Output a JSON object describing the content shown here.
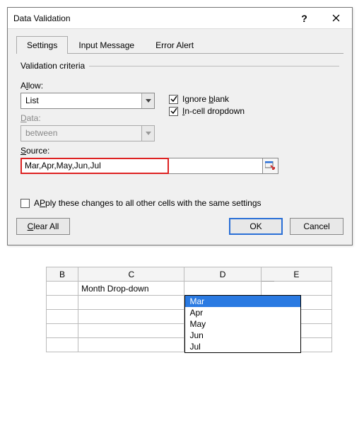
{
  "dialog": {
    "title": "Data Validation",
    "tabs": [
      {
        "label": "Settings"
      },
      {
        "label": "Input Message"
      },
      {
        "label": "Error Alert"
      }
    ],
    "active_tab": 0,
    "group_title": "Validation criteria",
    "allow": {
      "label_pre": "A",
      "label_u": "l",
      "label_post": "low:",
      "value": "List"
    },
    "data": {
      "label_pre": "",
      "label_u": "D",
      "label_post": "ata:",
      "value": "between",
      "enabled": false
    },
    "source": {
      "label_pre": "",
      "label_u": "S",
      "label_post": "ource:",
      "value": "Mar,Apr,May,Jun,Jul"
    },
    "checkboxes": {
      "ignore_blank": {
        "pre": "Ignore ",
        "u": "b",
        "post": "lank",
        "checked": true
      },
      "in_cell": {
        "pre": "",
        "u": "I",
        "post": "n-cell dropdown",
        "checked": true
      },
      "apply_all": {
        "pre": "Apply these changes to all other cells with the same settings",
        "u": "",
        "post": "",
        "label_u": "P",
        "checked": false
      }
    },
    "buttons": {
      "clear_all_pre": "",
      "clear_all_u": "C",
      "clear_all_post": "lear All",
      "ok": "OK",
      "cancel": "Cancel"
    }
  },
  "sheet": {
    "columns": [
      "B",
      "C",
      "D",
      "E"
    ],
    "c2": "Month Drop-down",
    "dropdown_options": [
      "Mar",
      "Apr",
      "May",
      "Jun",
      "Jul"
    ],
    "selected_option_index": 0
  }
}
